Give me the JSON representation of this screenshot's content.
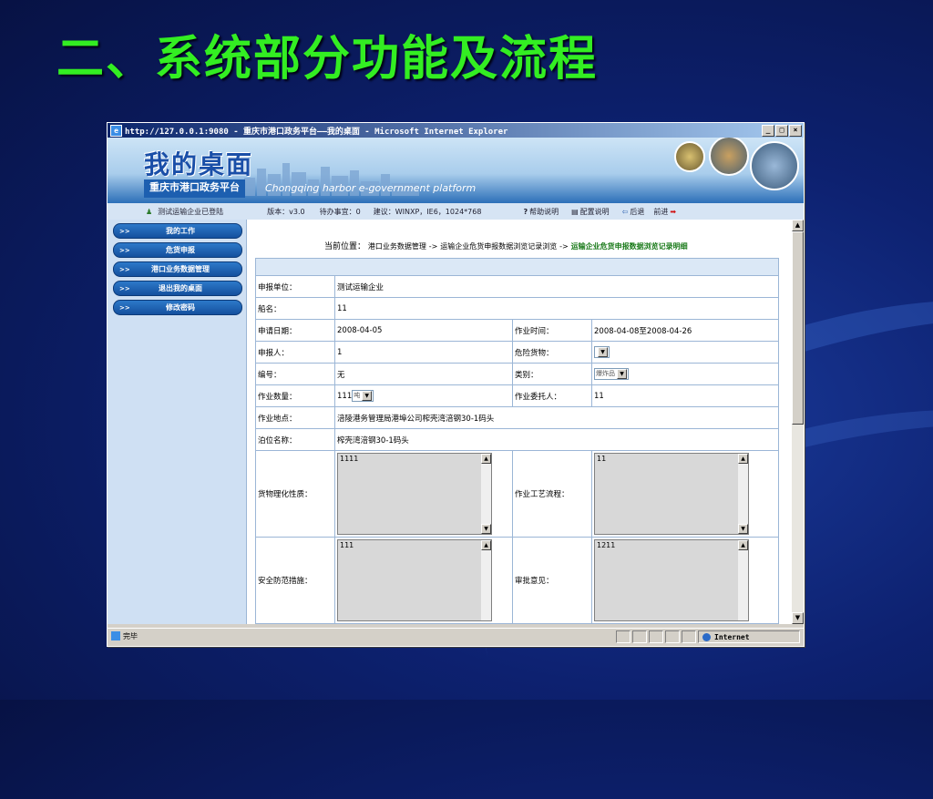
{
  "slide": {
    "title": "二、系统部分功能及流程"
  },
  "window": {
    "title": "http://127.0.0.1:9080 - 重庆市港口政务平台——我的桌面 - Microsoft Internet Explorer",
    "controls": {
      "minimize": "_",
      "restore": "□",
      "close": "×"
    }
  },
  "banner": {
    "title": "我的桌面",
    "subtitle": "重庆市港口政务平台",
    "english": "Chongqing harbor e-government platform"
  },
  "topbar": {
    "user_status": "测试运输企业已登陆",
    "version": "版本：v3.0",
    "pending": "待办事宜：0",
    "suggestion": "建议：WINXP，IE6，1024*768",
    "help": "帮助说明",
    "config": "配置说明",
    "back": "后退",
    "forward": "前进"
  },
  "sidebar": {
    "arrows": ">>",
    "items": [
      {
        "label": "我的工作"
      },
      {
        "label": "危货申报"
      },
      {
        "label": "港口业务数据管理"
      },
      {
        "label": "退出我的桌面"
      },
      {
        "label": "修改密码"
      }
    ]
  },
  "breadcrumb": {
    "prefix": "当前位置：",
    "level1": "港口业务数据管理",
    "sep": "->",
    "level2": "运输企业危货申报数据浏览记录浏览",
    "current": "运输企业危货申报数据浏览记录明细"
  },
  "form": {
    "unit_label": "申报单位：",
    "unit_value": "测试运输企业",
    "ship_label": "船名：",
    "ship_value": "11",
    "date_label": "申请日期：",
    "date_value": "2008-04-05",
    "optime_label": "作业时间：",
    "optime_value": "2008-04-08至2008-04-26",
    "applicant_label": "申报人：",
    "applicant_value": "1",
    "danger_label": "危险货物：",
    "danger_value": "",
    "number_label": "编号：",
    "number_value": "无",
    "category_label": "类别：",
    "category_value": "爆炸品",
    "qty_label": "作业数量：",
    "qty_value": "111",
    "qty_unit": "吨",
    "client_label": "作业委托人：",
    "client_value": "11",
    "location_label": "作业地点：",
    "location_value": "涪陵港务管理局港埠公司榨壳湾涪钢30-1码头",
    "berth_label": "泊位名称：",
    "berth_value": "榨壳湾涪钢30-1码头",
    "props_label": "货物理化性质：",
    "props_value": "1111",
    "process_label": "作业工艺流程：",
    "process_value": "11",
    "safety_label": "安全防范措施：",
    "safety_value": "111",
    "approval_label": "审批意见：",
    "approval_value": "1211"
  },
  "statusbar": {
    "text": "完毕",
    "zone": "Internet"
  }
}
